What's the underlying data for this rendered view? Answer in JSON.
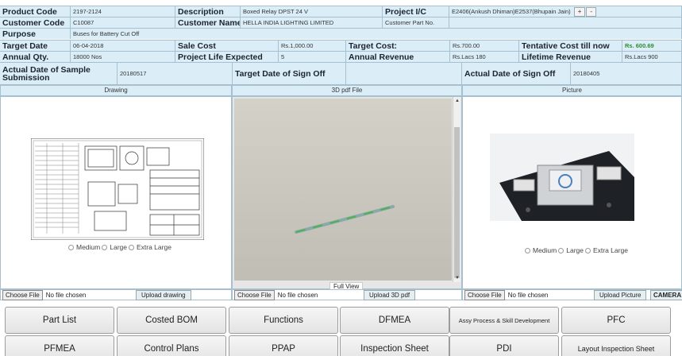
{
  "row1": {
    "product_code_label": "Product Code",
    "product_code": "2197-2124",
    "description_label": "Description",
    "description": "Boxed Relay DPST 24 V",
    "project_ic_label": "Project I/C",
    "project_ic": "E2406(Ankush Dhiman)E2537(Bhupain Jain)",
    "plus": "+",
    "minus": "-"
  },
  "row2": {
    "customer_code_label": "Customer Code",
    "customer_code": "C10087",
    "customer_name_label": "Customer Name",
    "customer_name": "HELLA INDIA LIGHTING LIMITED",
    "customer_part_label": "Customer Part No."
  },
  "row3": {
    "purpose_label": "Purpose",
    "purpose": "Buses for Battery Cut Off"
  },
  "row4": {
    "target_date_label": "Target Date",
    "target_date": "06-04-2018",
    "sale_cost_label": "Sale Cost",
    "sale_cost": "Rs.1,000.00",
    "target_cost_label": "Target Cost:",
    "target_cost": "Rs.700.00",
    "tentative_label": "Tentative Cost till now",
    "tentative": "Rs. 600.69"
  },
  "row5": {
    "annual_qty_label": "Annual Qty.",
    "annual_qty": "18000 Nos",
    "project_life_label": "Project Life Expected",
    "project_life": "5",
    "annual_revenue_label": "Annual Revenue",
    "annual_revenue": "Rs.Lacs 180",
    "lifetime_label": "Lifetime Revenue",
    "lifetime": "Rs.Lacs 900"
  },
  "row6": {
    "actual_sample_label": "Actual Date of Sample Submission",
    "actual_sample": "20180517",
    "target_signoff_label": "Target Date of Sign Off",
    "actual_signoff_label": "Actual Date of Sign Off",
    "actual_signoff": "20180405"
  },
  "panels": {
    "drawing_title": "Drawing",
    "pdf_title": "3D pdf File",
    "picture_title": "Picture",
    "full_view": "Full View",
    "size_medium": "Medium",
    "size_large": "Large",
    "size_xlarge": "Extra Large"
  },
  "files": {
    "choose": "Choose File",
    "no_file": "No file chosen",
    "upload_drawing": "Upload drawing",
    "upload_3d": "Upload 3D pdf",
    "upload_picture": "Upload Picture",
    "camera": "CAMERA"
  },
  "buttons_row1": [
    "Part List",
    "Costed BOM",
    "Functions",
    "DFMEA",
    "Assy Process & Skill Development",
    "PFC"
  ],
  "buttons_row2": [
    "PFMEA",
    "Control Plans",
    "PPAP",
    "Inspection Sheet",
    "PDI",
    "Layout Inspection Sheet"
  ],
  "colors": {
    "header_bg": "#dbeef7",
    "border": "#a7c0cf",
    "green": "#2e8b2e"
  }
}
